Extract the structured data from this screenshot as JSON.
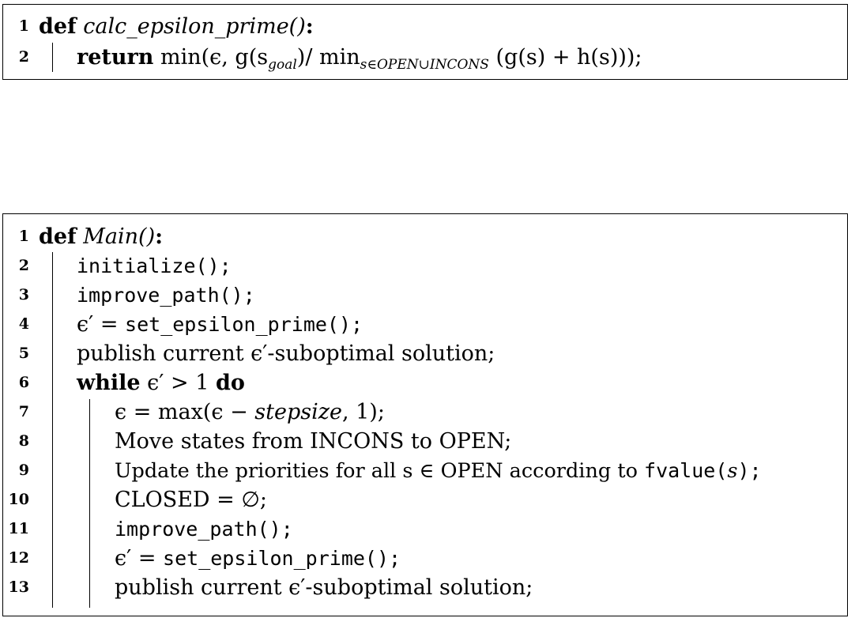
{
  "algorithm1": {
    "lines": [
      {
        "num": "1",
        "kw": "def",
        "name": "calc_epsilon_prime()",
        "colon": ":"
      },
      {
        "num": "2",
        "kw": "return",
        "text_a": "min(ϵ, g(s",
        "sub_goal": "goal",
        "text_b": ")/ min",
        "sub_set": "s∈OPEN∪INCONS",
        "text_c": "(g(s) + h(s)));"
      }
    ]
  },
  "algorithm2": {
    "header": {
      "num": "1",
      "kw": "def",
      "name": "Main()",
      "colon": ":"
    },
    "l2": {
      "num": "2",
      "code": "initialize();"
    },
    "l3": {
      "num": "3",
      "code": "improve_path();"
    },
    "l4": {
      "num": "4",
      "lhs": "ϵ′ = ",
      "code": "set_epsilon_prime();"
    },
    "l5": {
      "num": "5",
      "text": "publish current ϵ′-suboptimal solution;"
    },
    "l6": {
      "num": "6",
      "kw_while": "while",
      "cond": "ϵ′ > 1",
      "kw_do": "do"
    },
    "l7": {
      "num": "7",
      "text_a": "ϵ = max(ϵ − ",
      "var": "stepsize",
      "text_b": ", 1);"
    },
    "l8": {
      "num": "8",
      "text": "Move states from INCONS to OPEN;"
    },
    "l9": {
      "num": "9",
      "text_a": "Update the priorities for all s ∈ OPEN according to ",
      "func": "fvalue(",
      "var": "s",
      "func_end": ");"
    },
    "l10": {
      "num": "10",
      "text": "CLOSED = ∅;"
    },
    "l11": {
      "num": "11",
      "code": "improve_path();"
    },
    "l12": {
      "num": "12",
      "lhs": "ϵ′ = ",
      "code": "set_epsilon_prime();"
    },
    "l13": {
      "num": "13",
      "text": "publish current ϵ′-suboptimal solution;"
    }
  }
}
